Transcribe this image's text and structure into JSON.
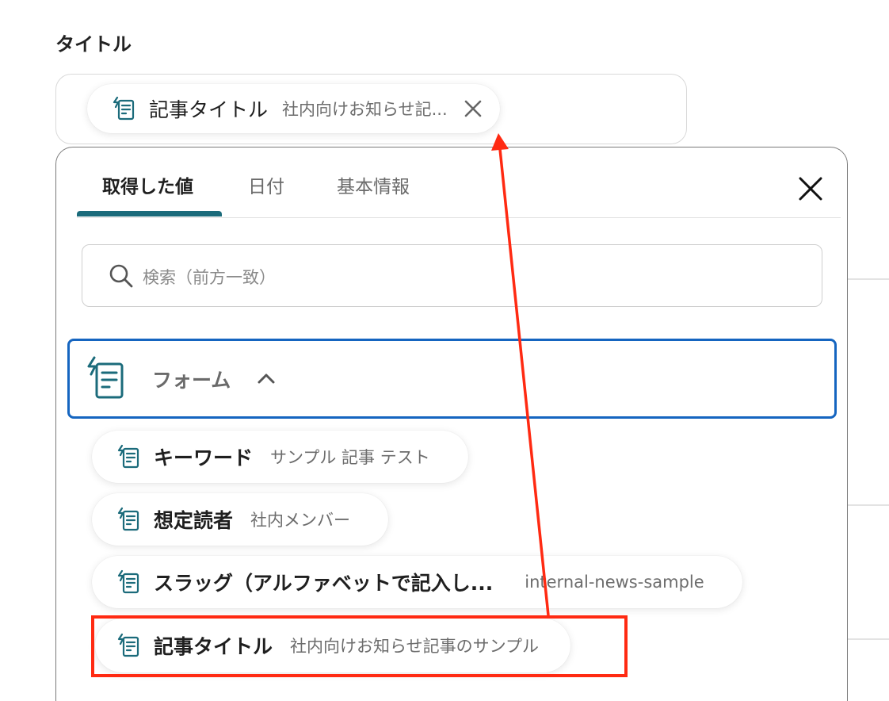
{
  "field": {
    "label": "タイトル",
    "chip": {
      "name": "記事タイトル",
      "value": "社内向けお知らせ記..."
    }
  },
  "popup": {
    "tabs": [
      {
        "label": "取得した値",
        "active": true
      },
      {
        "label": "日付",
        "active": false
      },
      {
        "label": "基本情報",
        "active": false
      }
    ],
    "search": {
      "placeholder": "検索（前方一致）"
    },
    "group": {
      "label": "フォーム",
      "expanded": true
    },
    "items": [
      {
        "name": "キーワード",
        "value": "サンプル 記事 テスト"
      },
      {
        "name": "想定読者",
        "value": "社内メンバー"
      },
      {
        "name": "スラッグ（アルファベットで記入し...",
        "value": "internal-news-sample"
      },
      {
        "name": "記事タイトル",
        "value": "社内向けお知らせ記事のサンプル"
      }
    ]
  },
  "colors": {
    "accent": "#1b6b7b",
    "group_border": "#1565c0",
    "annotation": "#ff2a12"
  }
}
